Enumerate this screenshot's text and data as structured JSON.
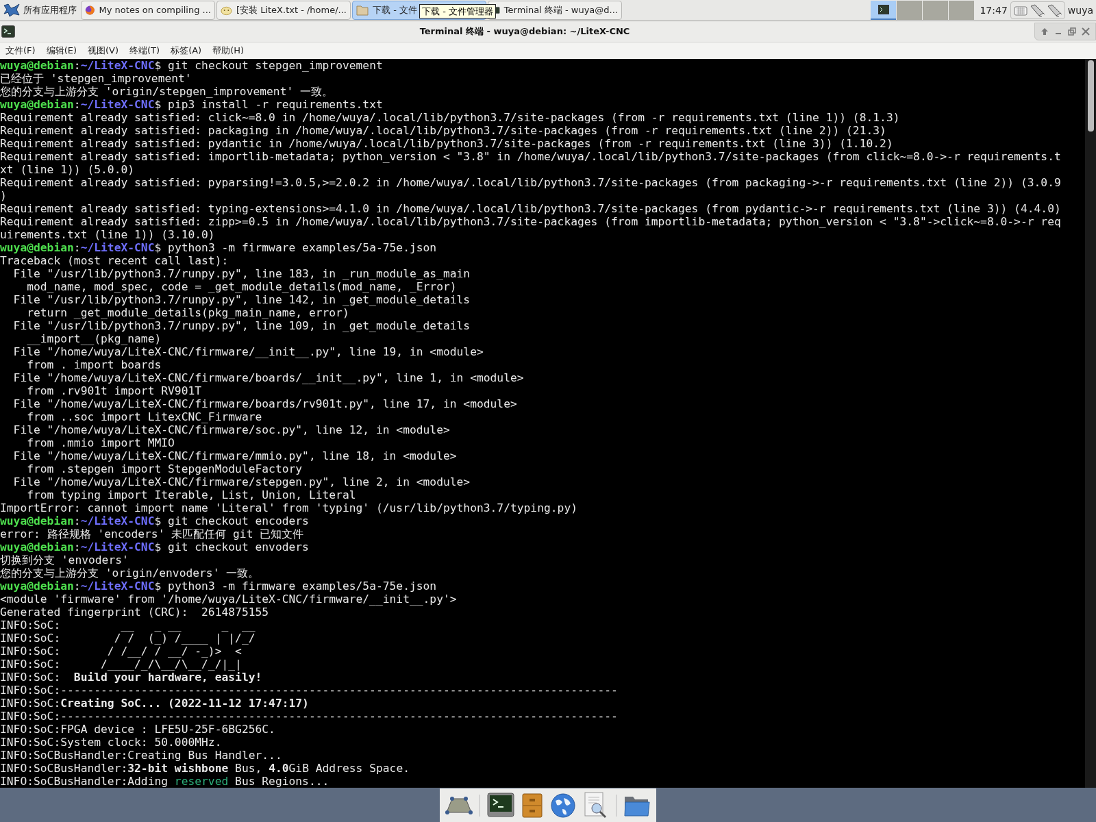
{
  "taskbar": {
    "start_label": "所有应用程序",
    "tasks": [
      {
        "label": "My notes on compiling ...",
        "kind": "browser",
        "selected": false
      },
      {
        "label": "[安装 LiteX.txt - /home/...",
        "kind": "editor",
        "selected": false
      },
      {
        "label": "下载 - 文件",
        "kind": "files",
        "selected": true
      },
      {
        "label": "Terminal 终端 - wuya@d...",
        "kind": "terminal",
        "selected": false
      }
    ],
    "tooltip": "下载 - 文件管理器",
    "workspaces": [
      {
        "selected": true
      },
      {
        "selected": false
      },
      {
        "selected": false
      },
      {
        "selected": false
      }
    ],
    "clock": "17:47",
    "user": "wuya"
  },
  "window": {
    "title": "Terminal 终端 - wuya@debian: ~/LiteX-CNC"
  },
  "menu": [
    "文件(F)",
    "编辑(E)",
    "视图(V)",
    "终端(T)",
    "标签(A)",
    "帮助(H)"
  ],
  "terminal": {
    "lines": [
      {
        "segments": [
          {
            "kind": "user",
            "text": "wuya@debian"
          },
          {
            "kind": "plain",
            "text": ":"
          },
          {
            "kind": "path",
            "text": "~/LiteX-CNC"
          },
          {
            "kind": "plain",
            "text": "$ git checkout stepgen_improvement"
          }
        ]
      },
      {
        "text": "已经位于 'stepgen_improvement'"
      },
      {
        "text": "您的分支与上游分支 'origin/stepgen_improvement' 一致。"
      },
      {
        "segments": [
          {
            "kind": "user",
            "text": "wuya@debian"
          },
          {
            "kind": "plain",
            "text": ":"
          },
          {
            "kind": "path",
            "text": "~/LiteX-CNC"
          },
          {
            "kind": "plain",
            "text": "$ pip3 install -r requirements.txt"
          }
        ]
      },
      {
        "text": "Requirement already satisfied: click~=8.0 in /home/wuya/.local/lib/python3.7/site-packages (from -r requirements.txt (line 1)) (8.1.3)"
      },
      {
        "text": "Requirement already satisfied: packaging in /home/wuya/.local/lib/python3.7/site-packages (from -r requirements.txt (line 2)) (21.3)"
      },
      {
        "text": "Requirement already satisfied: pydantic in /home/wuya/.local/lib/python3.7/site-packages (from -r requirements.txt (line 3)) (1.10.2)"
      },
      {
        "text": "Requirement already satisfied: importlib-metadata; python_version < \"3.8\" in /home/wuya/.local/lib/python3.7/site-packages (from click~=8.0->-r requirements.t"
      },
      {
        "text": "xt (line 1)) (5.0.0)"
      },
      {
        "text": "Requirement already satisfied: pyparsing!=3.0.5,>=2.0.2 in /home/wuya/.local/lib/python3.7/site-packages (from packaging->-r requirements.txt (line 2)) (3.0.9"
      },
      {
        "text": ")"
      },
      {
        "text": "Requirement already satisfied: typing-extensions>=4.1.0 in /home/wuya/.local/lib/python3.7/site-packages (from pydantic->-r requirements.txt (line 3)) (4.4.0)"
      },
      {
        "text": "Requirement already satisfied: zipp>=0.5 in /home/wuya/.local/lib/python3.7/site-packages (from importlib-metadata; python_version < \"3.8\"->click~=8.0->-r req"
      },
      {
        "text": "uirements.txt (line 1)) (3.10.0)"
      },
      {
        "segments": [
          {
            "kind": "user",
            "text": "wuya@debian"
          },
          {
            "kind": "plain",
            "text": ":"
          },
          {
            "kind": "path",
            "text": "~/LiteX-CNC"
          },
          {
            "kind": "plain",
            "text": "$ python3 -m firmware examples/5a-75e.json"
          }
        ]
      },
      {
        "text": "Traceback (most recent call last):"
      },
      {
        "text": "  File \"/usr/lib/python3.7/runpy.py\", line 183, in _run_module_as_main"
      },
      {
        "text": "    mod_name, mod_spec, code = _get_module_details(mod_name, _Error)"
      },
      {
        "text": "  File \"/usr/lib/python3.7/runpy.py\", line 142, in _get_module_details"
      },
      {
        "text": "    return _get_module_details(pkg_main_name, error)"
      },
      {
        "text": "  File \"/usr/lib/python3.7/runpy.py\", line 109, in _get_module_details"
      },
      {
        "text": "    __import__(pkg_name)"
      },
      {
        "text": "  File \"/home/wuya/LiteX-CNC/firmware/__init__.py\", line 19, in <module>"
      },
      {
        "text": "    from . import boards"
      },
      {
        "text": "  File \"/home/wuya/LiteX-CNC/firmware/boards/__init__.py\", line 1, in <module>"
      },
      {
        "text": "    from .rv901t import RV901T"
      },
      {
        "text": "  File \"/home/wuya/LiteX-CNC/firmware/boards/rv901t.py\", line 17, in <module>"
      },
      {
        "text": "    from ..soc import LitexCNC_Firmware"
      },
      {
        "text": "  File \"/home/wuya/LiteX-CNC/firmware/soc.py\", line 12, in <module>"
      },
      {
        "text": "    from .mmio import MMIO"
      },
      {
        "text": "  File \"/home/wuya/LiteX-CNC/firmware/mmio.py\", line 18, in <module>"
      },
      {
        "text": "    from .stepgen import StepgenModuleFactory"
      },
      {
        "text": "  File \"/home/wuya/LiteX-CNC/firmware/stepgen.py\", line 2, in <module>"
      },
      {
        "text": "    from typing import Iterable, List, Union, Literal"
      },
      {
        "text": "ImportError: cannot import name 'Literal' from 'typing' (/usr/lib/python3.7/typing.py)"
      },
      {
        "segments": [
          {
            "kind": "user",
            "text": "wuya@debian"
          },
          {
            "kind": "plain",
            "text": ":"
          },
          {
            "kind": "path",
            "text": "~/LiteX-CNC"
          },
          {
            "kind": "plain",
            "text": "$ git checkout encoders"
          }
        ]
      },
      {
        "text": "error: 路径规格 'encoders' 未匹配任何 git 已知文件"
      },
      {
        "segments": [
          {
            "kind": "user",
            "text": "wuya@debian"
          },
          {
            "kind": "plain",
            "text": ":"
          },
          {
            "kind": "path",
            "text": "~/LiteX-CNC"
          },
          {
            "kind": "plain",
            "text": "$ git checkout envoders"
          }
        ]
      },
      {
        "text": "切换到分支 'envoders'"
      },
      {
        "text": "您的分支与上游分支 'origin/envoders' 一致。"
      },
      {
        "segments": [
          {
            "kind": "user",
            "text": "wuya@debian"
          },
          {
            "kind": "plain",
            "text": ":"
          },
          {
            "kind": "path",
            "text": "~/LiteX-CNC"
          },
          {
            "kind": "plain",
            "text": "$ python3 -m firmware examples/5a-75e.json"
          }
        ]
      },
      {
        "text": "<module 'firmware' from '/home/wuya/LiteX-CNC/firmware/__init__.py'>"
      },
      {
        "text": "Generated fingerprint (CRC):  2614875155"
      },
      {
        "text": "INFO:SoC:         __   _ __      _  __"
      },
      {
        "text": "INFO:SoC:        / /  (_) /____ | |/_/"
      },
      {
        "text": "INFO:SoC:       / /__/ / __/ -_)>  <"
      },
      {
        "text": "INFO:SoC:      /____/_/\\__/\\__/_/|_|"
      },
      {
        "text": "INFO:SoC:  **Build your hardware, easily!**"
      },
      {
        "text": "INFO:SoC:-----------------------------------------------------------------------------------"
      },
      {
        "text": "INFO:SoC:**Creating SoC... (2022-11-12 17:47:17)**"
      },
      {
        "text": "INFO:SoC:-----------------------------------------------------------------------------------"
      },
      {
        "text": "INFO:SoC:FPGA device : LFE5U-25F-6BG256C."
      },
      {
        "text": "INFO:SoC:System clock: 50.000MHz."
      },
      {
        "text": "INFO:SoCBusHandler:Creating Bus Handler..."
      },
      {
        "text": "INFO:SoCBusHandler:**32-bit wishbone** Bus, **4.0**GiB Address Space."
      },
      {
        "segments": [
          {
            "kind": "plain",
            "text": "INFO:SoCBusHandler:Adding "
          },
          {
            "kind": "green",
            "text": "reserved"
          },
          {
            "kind": "plain",
            "text": " Bus Regions..."
          }
        ]
      }
    ]
  }
}
